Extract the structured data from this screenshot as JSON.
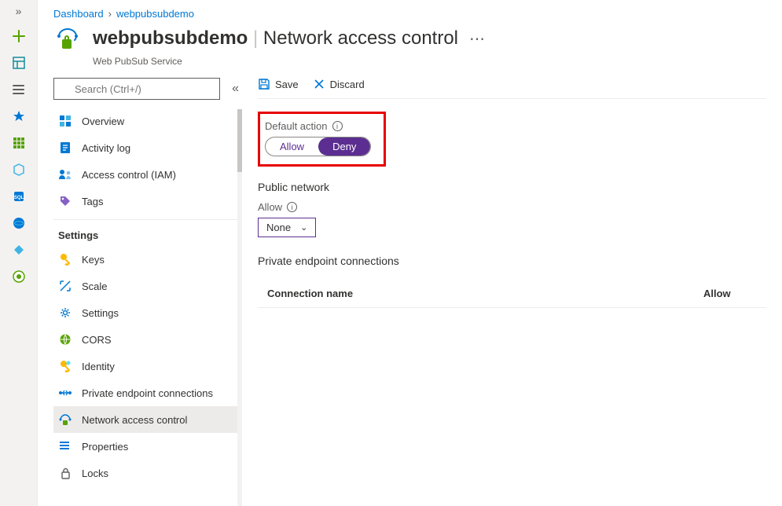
{
  "breadcrumbs": {
    "root": "Dashboard",
    "current": "webpubsubdemo"
  },
  "header": {
    "resource_name": "webpubsubdemo",
    "page_title": "Network access control",
    "service_type": "Web PubSub Service"
  },
  "search": {
    "placeholder": "Search (Ctrl+/)"
  },
  "nav": {
    "main": [
      {
        "label": "Overview"
      },
      {
        "label": "Activity log"
      },
      {
        "label": "Access control (IAM)"
      },
      {
        "label": "Tags"
      }
    ],
    "settings_group": "Settings",
    "settings": [
      {
        "label": "Keys"
      },
      {
        "label": "Scale"
      },
      {
        "label": "Settings"
      },
      {
        "label": "CORS"
      },
      {
        "label": "Identity"
      },
      {
        "label": "Private endpoint connections"
      },
      {
        "label": "Network access control",
        "selected": true
      },
      {
        "label": "Properties"
      },
      {
        "label": "Locks"
      }
    ]
  },
  "toolbar": {
    "save": "Save",
    "discard": "Discard"
  },
  "content": {
    "default_action_label": "Default action",
    "toggle": {
      "allow": "Allow",
      "deny": "Deny",
      "selected": "Deny"
    },
    "public_network_label": "Public network",
    "allow_label": "Allow",
    "allow_value": "None",
    "pec_label": "Private endpoint connections",
    "table": {
      "col_name": "Connection name",
      "col_allow": "Allow"
    }
  },
  "colors": {
    "accent": "#0078d4",
    "purple": "#5c2e91",
    "highlight": "#e60000"
  }
}
